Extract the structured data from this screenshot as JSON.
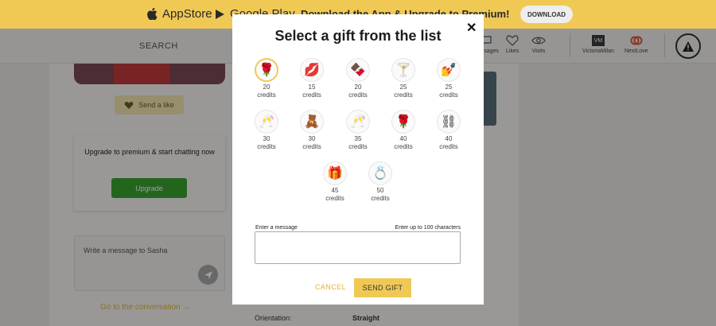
{
  "banner": {
    "appstore_label": "AppStore",
    "googleplay_label": "Google Play",
    "message": "Download the App & Upgrade to Premium!",
    "download_label": "DOWNLOAD",
    "color": "#f0c955"
  },
  "header": {
    "search_label": "SEARCH",
    "nav": [
      {
        "label": "Messages",
        "icon": "chat-icon"
      },
      {
        "label": "Likes",
        "icon": "heart-icon"
      },
      {
        "label": "Visits",
        "icon": "eye-icon"
      },
      {
        "label": "VictoriaMilan",
        "icon": "vm-logo-icon"
      },
      {
        "label": "NextLove",
        "icon": "nextlove-logo-icon"
      }
    ],
    "alert_icon": "warning-icon"
  },
  "profile": {
    "send_like_label": "Send a like",
    "premium_text": "Upgrade to premium & start chatting now",
    "upgrade_label": "Upgrade",
    "message_placeholder": "Write a message to Sasha",
    "goto_conversation": "Go to the conversation →",
    "orientation_label": "Orientation:",
    "orientation_value": "Straight"
  },
  "modal": {
    "title": "Select a gift from the list",
    "close": "✕",
    "gifts": [
      {
        "icon": "🌹",
        "name": "rose-icon",
        "amount": "20",
        "unit": "credits",
        "selected": true
      },
      {
        "icon": "💋",
        "name": "lips-icon",
        "amount": "15",
        "unit": "credits"
      },
      {
        "icon": "🍫",
        "name": "chocolate-heart-icon",
        "amount": "20",
        "unit": "credits"
      },
      {
        "icon": "🍸",
        "name": "cocktail-icon",
        "amount": "25",
        "unit": "credits"
      },
      {
        "icon": "💅",
        "name": "manicure-icon",
        "amount": "25",
        "unit": "credits"
      },
      {
        "icon": "🥂",
        "name": "champagne-glass-icon",
        "amount": "30",
        "unit": "credits"
      },
      {
        "icon": "🧸",
        "name": "teddy-bear-icon",
        "amount": "30",
        "unit": "credits"
      },
      {
        "icon": "🥂",
        "name": "champagne-toast-icon",
        "amount": "35",
        "unit": "credits"
      },
      {
        "icon": "🌹",
        "name": "rose-bouquet-icon",
        "amount": "40",
        "unit": "credits"
      },
      {
        "icon": "⛓",
        "name": "handcuffs-icon",
        "amount": "40",
        "unit": "credits"
      },
      {
        "icon": "🎁",
        "name": "gift-box-icon",
        "amount": "45",
        "unit": "credits"
      },
      {
        "icon": "💍",
        "name": "ring-icon",
        "amount": "50",
        "unit": "credits"
      }
    ],
    "message_label": "Enter a message",
    "char_limit": "Enter up to 100 characters",
    "message_value": "",
    "cancel_label": "CANCEL",
    "send_label": "SEND GIFT",
    "accent_color": "#f0c955"
  }
}
